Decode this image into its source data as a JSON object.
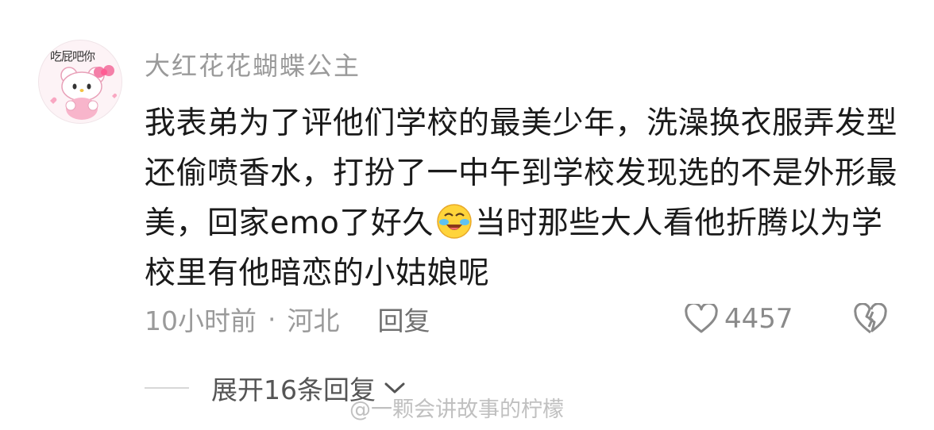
{
  "comment": {
    "avatar_caption": "吃屁吧你",
    "username": "大红花花蝴蝶公主",
    "text_part1": "我表弟为了评他们学校的最美少年，洗澡换衣服弄发型还偷喷香水，打扮了一中午到学校发现选的不是外形最美，回家emo了好久",
    "emoji": "crying-laughing-emoji",
    "text_part2": "当时那些大人看他折腾以为学校里有他暗恋的小姑娘呢",
    "time": "10小时前",
    "separator": "·",
    "location": "河北",
    "reply_label": "回复",
    "like_count": "4457",
    "expand_label": "展开16条回复"
  },
  "watermark": {
    "text": "@一颗会讲故事的柠檬"
  },
  "colors": {
    "username": "#9a9a9a",
    "body_text": "#1a1a1a",
    "meta": "#9a9a9a"
  }
}
